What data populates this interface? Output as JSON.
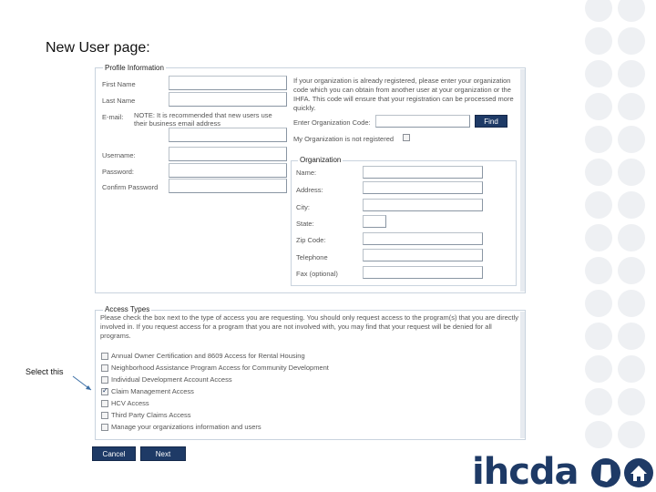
{
  "page_heading": "New User page:",
  "profile": {
    "legend": "Profile Information",
    "first_name_label": "First Name",
    "last_name_label": "Last Name",
    "email_label": "E-mail:",
    "email_note": "NOTE: It is recommended that new users use their business email address",
    "username_label": "Username:",
    "password_label": "Password:",
    "confirm_password_label": "Confirm Password",
    "org_intro": "If your organization is already registered, please enter your organization code which you can obtain from another user at your organization or the IHFA. This code will ensure that your registration can be processed more quickly.",
    "org_code_label": "Enter Organization Code:",
    "find_button": "Find",
    "not_registered_label": "My Organization is not registered"
  },
  "organization": {
    "legend": "Organization",
    "name_label": "Name:",
    "address_label": "Address:",
    "city_label": "City:",
    "state_label": "State:",
    "zip_label": "Zip Code:",
    "telephone_label": "Telephone",
    "fax_label": "Fax (optional)"
  },
  "access": {
    "legend": "Access Types",
    "instructions": "Please check the box next to the type of access you are requesting. You should only request access to the program(s) that you are directly involved in. If you request access for a program that you are not involved with, you may find that your request will be denied for all programs.",
    "items": [
      {
        "label": "Annual Owner Certification and 8609 Access for Rental Housing",
        "checked": false
      },
      {
        "label": "Neighborhood Assistance Program Access for Community Development",
        "checked": false
      },
      {
        "label": "Individual Development Account Access",
        "checked": false
      },
      {
        "label": "Claim Management Access",
        "checked": true
      },
      {
        "label": "HCV Access",
        "checked": false
      },
      {
        "label": "Third Party Claims Access",
        "checked": false
      },
      {
        "label": "Manage your organizations information and users",
        "checked": false
      }
    ]
  },
  "buttons": {
    "cancel": "Cancel",
    "next": "Next"
  },
  "annotation": "Select this",
  "logo": "ihcda"
}
